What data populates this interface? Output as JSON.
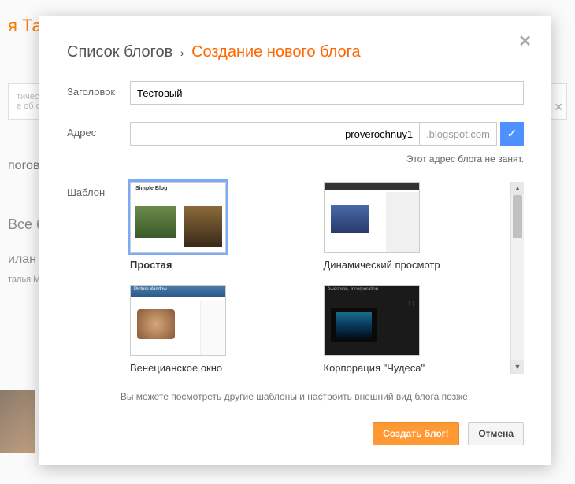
{
  "modal": {
    "breadcrumb_list": "Список блогов",
    "breadcrumb_sep": "›",
    "breadcrumb_current": "Создание нового блога"
  },
  "form": {
    "title_label": "Заголовок",
    "title_value": "Тестовый",
    "address_label": "Адрес",
    "address_value": "proverochnuy1",
    "address_suffix": ".blogspot.com",
    "address_hint": "Этот адрес блога не занят.",
    "template_label": "Шаблон"
  },
  "templates": [
    {
      "name": "Простая",
      "selected": true
    },
    {
      "name": "Динамический просмотр",
      "selected": false
    },
    {
      "name": "Венецианское окно",
      "selected": false
    },
    {
      "name": "Корпорация \"Чудеса\"",
      "selected": false
    }
  ],
  "hint": "Вы можете посмотреть другие шаблоны и настроить внешний вид блога позже.",
  "buttons": {
    "create": "Создать блог!",
    "cancel": "Отмена"
  },
  "bg": {
    "tab": "я Та",
    "card1a": "тическо",
    "card1b": "е об об",
    "blogs": "поговᴏ",
    "all": "Все б",
    "side1": "илан",
    "side2": "талья М"
  }
}
